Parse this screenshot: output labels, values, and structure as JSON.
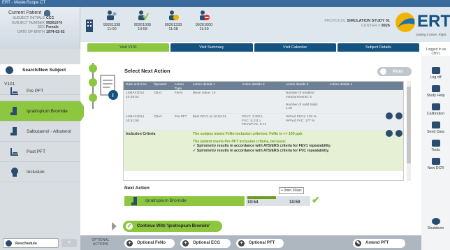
{
  "window": {
    "title": "ERT - MasterScope CT"
  },
  "patient": {
    "title": "Current Patient",
    "fields": [
      {
        "k": "SUBJECT INITIALS",
        "v": "CCC"
      },
      {
        "k": "SUBJECT NUMBER",
        "v": "99261076"
      },
      {
        "k": "SEX",
        "v": "Female"
      },
      {
        "k": "DATE OF BIRTH",
        "v": "1974-02-02"
      }
    ]
  },
  "visits": [
    {
      "id": "99261338",
      "time": "11:00"
    },
    {
      "id": "99261005",
      "time": "10:58"
    },
    {
      "id": "99261333",
      "time": "11:08"
    },
    {
      "id": "99261000",
      "time": "11:59"
    }
  ],
  "protocol": {
    "label": "PROTOCOL",
    "value": "SIMULATION STUDY 01",
    "center_label": "CENTER #",
    "center_value": "9926"
  },
  "brand": {
    "name": "ERT",
    "tagline": "Getting it Done. Right."
  },
  "tabs": [
    "Visit V101",
    "Visit Summary",
    "Visit Calendar",
    "Subject Details"
  ],
  "logged_in": "Logged in as CBVL",
  "nav": {
    "search": "Search/New Subject",
    "visit": "V101",
    "items": [
      "Pre PFT",
      "Ipratropium Bromide",
      "Salbutamol - Albuterol",
      "Post PFT",
      "Inclusion"
    ],
    "reschedule": "Reschedule",
    "close": "×"
  },
  "action": {
    "title": "Select Next Action",
    "print": "Print",
    "columns": [
      "Date and time",
      "Operator",
      "Action Type",
      "Action details 1",
      "Action details 2",
      "Action details 3",
      "Action details 4"
    ],
    "rows": [
      [
        "14MAY2014 10:39:54",
        "CBVL",
        "FeNo",
        "Mean value: 16",
        "",
        "Number of enabled measurements: 5\n\nNumber of valid trials: 1.00",
        ""
      ],
      [
        "14MAY2014 10:51:58",
        "CBVL",
        "Pre PFT",
        "Best FEV1 at 10:54:21",
        "FEV1: 3.302 L\nFVC: 5.211 L\nFEV1/FVC: 0.74",
        "%Pred FEV1: 102 %\n%Pred FVC: 177 %",
        ""
      ]
    ],
    "inclusion_label": "Inclusion Criteria",
    "inclusion_lines": [
      "The subject meets FeNo inclusion criterion: FeNo is <= 100 ppb",
      "The patient meets Pre PFT inclusion criteria, because:",
      "✓ Spirometry results in accordance with ATS/ERS criteria for FEV1 repeatability.",
      "✓ Spirometry results in accordance with ATS/ERS criteria for FVC repeatability."
    ]
  },
  "next_action": {
    "title": "Next Action",
    "name": "Ipratropium Bromide",
    "start": "10:54",
    "end": "10:59",
    "tooltip": "+ 0min 26sec",
    "progress": 0.45
  },
  "continue_label": "Continue With 'Ipratropium Bromide'",
  "optional": {
    "label": "OPTIONAL ACTIONS",
    "buttons": [
      "Optional FeNo",
      "Optional ECG",
      "Optional PFT"
    ],
    "amend": "Amend PFT"
  },
  "right_menu": [
    "Log off",
    "Study Help",
    "Calibration",
    "Send Data",
    "Tools",
    "New DCR",
    "Shutdown"
  ],
  "colors": {
    "accent": "#8dc63f",
    "navy": "#14527f"
  }
}
